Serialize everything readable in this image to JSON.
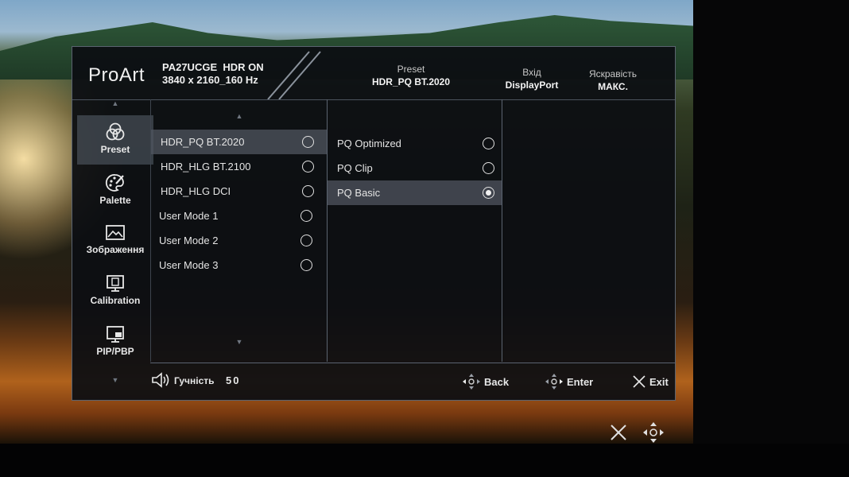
{
  "brand": "ProArt",
  "model": {
    "name": "PA27UCGE",
    "hdr": "HDR ON",
    "resolution": "3840 x 2160_160 Hz"
  },
  "header": {
    "preset_label": "Preset",
    "preset_value": "HDR_PQ BT.2020",
    "input_label": "Вхід",
    "input_value": "DisplayPort",
    "brightness_label": "Яскравість",
    "brightness_value": "МАКС."
  },
  "sidebar": {
    "items": [
      {
        "label": "Preset",
        "icon": "preset-icon",
        "active": true
      },
      {
        "label": "Palette",
        "icon": "palette-icon",
        "active": false
      },
      {
        "label": "Зображення",
        "icon": "image-icon",
        "active": false
      },
      {
        "label": "Calibration",
        "icon": "calibration-icon",
        "active": false
      },
      {
        "label": "PIP/PBP",
        "icon": "pip-pbp-icon",
        "active": false
      }
    ]
  },
  "presets": [
    {
      "label": "HDR_PQ BT.2020",
      "selected": true,
      "checked": false
    },
    {
      "label": "HDR_HLG BT.2100",
      "selected": false,
      "checked": false
    },
    {
      "label": "HDR_HLG DCI",
      "selected": false,
      "checked": false
    },
    {
      "label": "User Mode 1",
      "selected": false,
      "checked": false
    },
    {
      "label": "User Mode 2",
      "selected": false,
      "checked": false
    },
    {
      "label": "User Mode 3",
      "selected": false,
      "checked": false
    }
  ],
  "submodes": [
    {
      "label": "PQ Optimized",
      "selected": false,
      "checked": false
    },
    {
      "label": "PQ Clip",
      "selected": false,
      "checked": false
    },
    {
      "label": "PQ Basic",
      "selected": true,
      "checked": true
    }
  ],
  "footer": {
    "volume_label": "Гучність",
    "volume_value": "50",
    "back_label": "Back",
    "enter_label": "Enter",
    "exit_label": "Exit"
  },
  "colors": {
    "panel": "#0c0e12",
    "border": "#5b6470",
    "highlight": "#50565f",
    "text": "#e6e6e6"
  }
}
